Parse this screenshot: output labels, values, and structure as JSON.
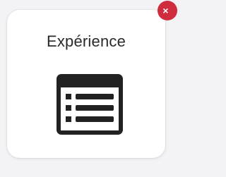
{
  "card": {
    "title": "Expérience",
    "icon": "table-list-icon"
  },
  "badge": {
    "icon": "close-icon",
    "glyph": "×",
    "color": "#cf2c3d"
  }
}
